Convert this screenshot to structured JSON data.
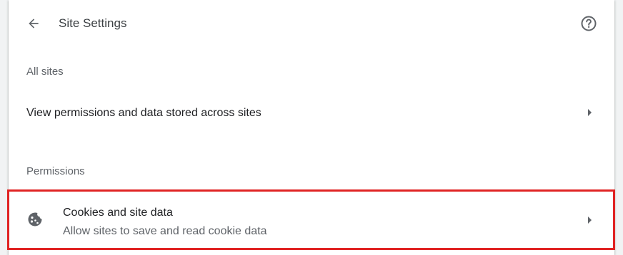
{
  "header": {
    "title": "Site Settings",
    "back_icon": "arrow-back-icon",
    "help_icon": "help-icon"
  },
  "all_sites": {
    "section_label": "All sites",
    "row_label": "View permissions and data stored across sites",
    "arrow_icon": "chevron-right-icon"
  },
  "permissions": {
    "section_label": "Permissions",
    "items": [
      {
        "title": "Cookies and site data",
        "subtitle": "Allow sites to save and read cookie data",
        "icon": "cookie-icon",
        "arrow_icon": "chevron-right-icon",
        "highlighted": true
      }
    ]
  },
  "colors": {
    "highlight_border": "#e02323",
    "text_primary": "#202124",
    "text_secondary": "#5f6368"
  }
}
